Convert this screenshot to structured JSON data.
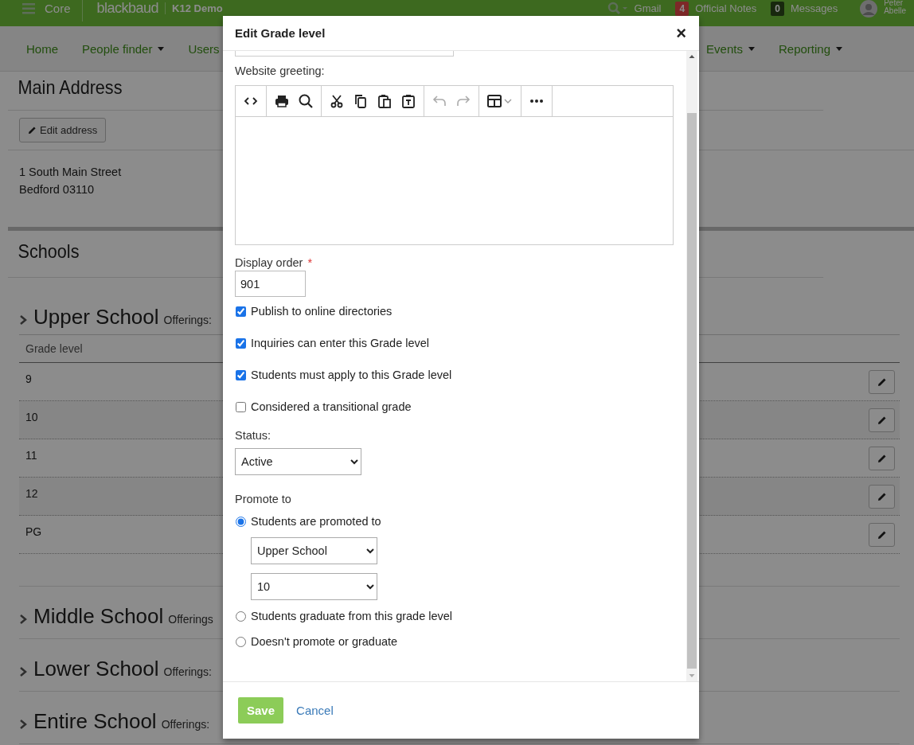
{
  "top_bar": {
    "menu_label": "Core",
    "logo": "blackbaud",
    "site": "K12 Demo",
    "gmail": "Gmail",
    "notes": {
      "count": "4",
      "label": "Official Notes"
    },
    "messages": {
      "count": "0",
      "label": "Messages"
    },
    "user": [
      "Peter",
      "Abelle"
    ]
  },
  "nav": [
    {
      "label": "Home",
      "dropdown": false
    },
    {
      "label": "People finder",
      "dropdown": true
    },
    {
      "label": "Users",
      "dropdown": false
    },
    {
      "label": "Events",
      "dropdown": true
    },
    {
      "label": "Reporting",
      "dropdown": true
    }
  ],
  "address": {
    "title": "Main Address",
    "edit_button": "Edit address",
    "lines": [
      "1 South Main Street",
      "Bedford 03110"
    ]
  },
  "schools": {
    "title": "Schools",
    "sections": [
      {
        "name": "Upper School",
        "offerings": "Offerings:",
        "column": "Grade level",
        "rows": [
          "9",
          "10",
          "11",
          "12",
          "PG"
        ]
      },
      {
        "name": "Middle School",
        "offerings": "Offerings"
      },
      {
        "name": "Lower School",
        "offerings": "Offerings:"
      },
      {
        "name": "Entire School",
        "offerings": "Offerings:"
      }
    ]
  },
  "modal": {
    "title": "Edit Grade level",
    "close": "×",
    "greeting_label": "Website greeting:",
    "toolbar": [
      [
        {
          "kind": "code",
          "disabled": false
        }
      ],
      [
        {
          "kind": "print",
          "disabled": false
        },
        {
          "kind": "search",
          "disabled": false
        }
      ],
      [
        {
          "kind": "cut",
          "disabled": false
        },
        {
          "kind": "copy",
          "disabled": false
        },
        {
          "kind": "paste",
          "disabled": false
        },
        {
          "kind": "paste-text",
          "disabled": false
        }
      ],
      [
        {
          "kind": "undo",
          "disabled": true
        },
        {
          "kind": "redo",
          "disabled": true
        }
      ],
      [
        {
          "kind": "table",
          "disabled": false
        }
      ],
      [
        {
          "kind": "more",
          "disabled": false
        }
      ]
    ],
    "display_order": {
      "label": "Display order",
      "required": "*",
      "value": "901"
    },
    "checkboxes": [
      {
        "label": "Publish to online directories",
        "checked": true
      },
      {
        "label": "Inquiries can enter this Grade level",
        "checked": true
      },
      {
        "label": "Students must apply to this Grade level",
        "checked": true
      },
      {
        "label": "Considered a transitional grade",
        "checked": false
      }
    ],
    "status": {
      "label": "Status:",
      "value": "Active"
    },
    "promote": {
      "label": "Promote to",
      "options": [
        {
          "label": "Students are promoted to",
          "selected": true,
          "selects": [
            "Upper School",
            "10"
          ]
        },
        {
          "label": "Students graduate from this grade level",
          "selected": false
        },
        {
          "label": "Doesn't promote or graduate",
          "selected": false
        }
      ]
    },
    "save": "Save",
    "cancel": "Cancel"
  }
}
